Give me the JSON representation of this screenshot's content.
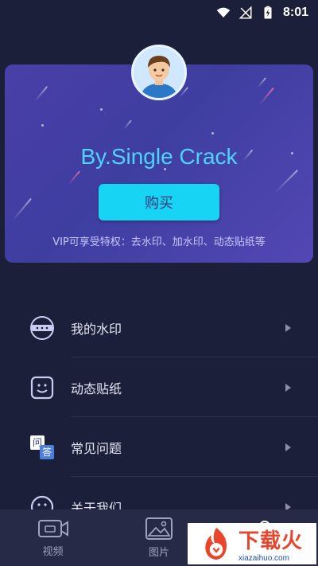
{
  "status_bar": {
    "time": "8:01"
  },
  "profile": {
    "username": "By.Single Crack",
    "buy_label": "购买",
    "vip_description": "VIP可享受特权：去水印、加水印、动态贴纸等"
  },
  "menu": {
    "items": [
      {
        "label": "我的水印",
        "icon": "watermark-icon"
      },
      {
        "label": "动态贴纸",
        "icon": "sticker-icon"
      },
      {
        "label": "常见问题",
        "icon": "faq-icon",
        "icon_text_top": "问",
        "icon_text_bottom": "答"
      },
      {
        "label": "关于我们",
        "icon": "about-icon"
      }
    ]
  },
  "bottom_nav": {
    "tabs": [
      {
        "label": "视频",
        "icon": "video-icon"
      },
      {
        "label": "图片",
        "icon": "image-icon"
      }
    ]
  },
  "watermark": {
    "title": "下载火",
    "url": "xiazaihuo.com"
  },
  "colors": {
    "accent": "#17d4f5",
    "username": "#4fd3ff",
    "background": "#1c1f3a"
  }
}
